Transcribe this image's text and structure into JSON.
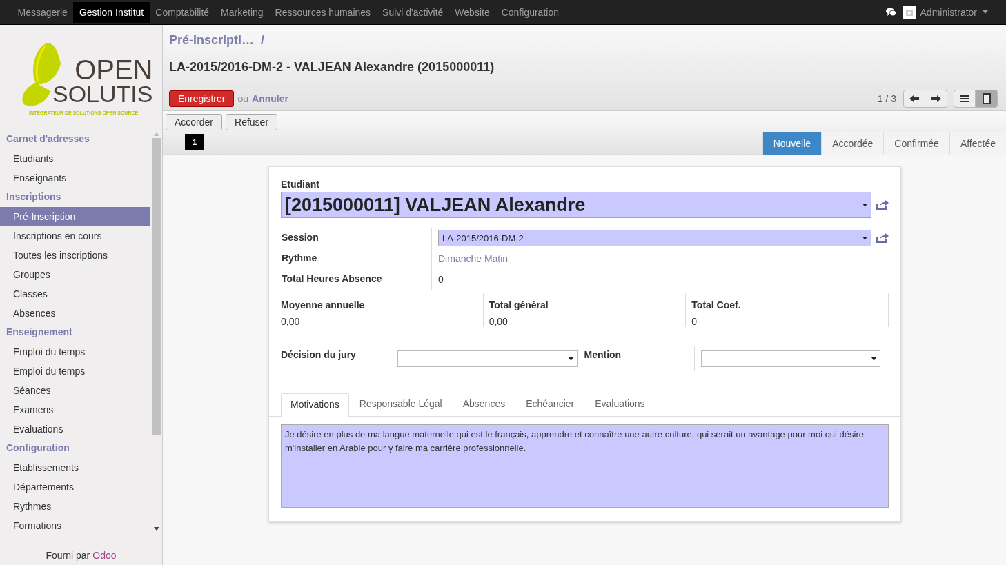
{
  "top_menu": [
    {
      "label": "Messagerie",
      "selected": false
    },
    {
      "label": "Gestion Institut",
      "selected": true
    },
    {
      "label": "Comptabilité",
      "selected": false
    },
    {
      "label": "Marketing",
      "selected": false
    },
    {
      "label": "Ressources humaines",
      "selected": false
    },
    {
      "label": "Suivi d'activité",
      "selected": false
    },
    {
      "label": "Website",
      "selected": false
    },
    {
      "label": "Configuration",
      "selected": false
    }
  ],
  "user": {
    "name": "Administrator"
  },
  "logo": {
    "line_1": "OPEN",
    "line_2": "SOLUTIS",
    "tagline": "INTEGRATEUR DE SOLUTIONS OPEN SOURCE"
  },
  "sidebar": {
    "sections": [
      {
        "title": "Carnet d'adresses",
        "items": [
          {
            "label": "Etudiants",
            "selected": false
          },
          {
            "label": "Enseignants",
            "selected": false
          }
        ]
      },
      {
        "title": "Inscriptions",
        "items": [
          {
            "label": "Pré-Inscription",
            "selected": true
          },
          {
            "label": "Inscriptions en cours",
            "selected": false
          },
          {
            "label": "Toutes les inscriptions",
            "selected": false
          },
          {
            "label": "Groupes",
            "selected": false
          },
          {
            "label": "Classes",
            "selected": false
          },
          {
            "label": "Absences",
            "selected": false
          }
        ]
      },
      {
        "title": "Enseignement",
        "items": [
          {
            "label": "Emploi du temps",
            "selected": false
          },
          {
            "label": "Emploi du temps",
            "selected": false
          },
          {
            "label": "Séances",
            "selected": false
          },
          {
            "label": "Examens",
            "selected": false
          },
          {
            "label": "Evaluations",
            "selected": false
          }
        ]
      },
      {
        "title": "Configuration",
        "items": [
          {
            "label": "Etablissements",
            "selected": false
          },
          {
            "label": "Départements",
            "selected": false
          },
          {
            "label": "Rythmes",
            "selected": false
          },
          {
            "label": "Formations",
            "selected": false
          }
        ]
      }
    ],
    "footer_text": "Fourni par",
    "footer_link": "Odoo"
  },
  "breadcrumb": {
    "parent": "Pré-Inscripti…",
    "separator": "/"
  },
  "record_title": "LA-2015/2016-DM-2 - VALJEAN Alexandre (2015000011)",
  "save_button": "Enregistrer",
  "or_text": "ou",
  "cancel_link": "Annuler",
  "pager": "1 / 3",
  "view_switch": [
    {
      "kind": "list",
      "selected": false
    },
    {
      "kind": "form",
      "selected": true
    }
  ],
  "action_buttons": [
    "Accorder",
    "Refuser"
  ],
  "badge": "1",
  "stages": [
    {
      "label": "Nouvelle",
      "selected": true
    },
    {
      "label": "Accordée",
      "selected": false
    },
    {
      "label": "Confirmée",
      "selected": false
    },
    {
      "label": "Affectée",
      "selected": false
    }
  ],
  "form": {
    "student_label": "Etudiant",
    "student_value": "[2015000011] VALJEAN Alexandre",
    "fields": [
      {
        "label": "Session",
        "kind": "select",
        "value": "LA-2015/2016-DM-2"
      },
      {
        "label": "Rythme",
        "kind": "link",
        "value": "Dimanche Matin"
      },
      {
        "label": "Total Heures Absence",
        "kind": "text",
        "value": "0"
      }
    ],
    "stats": [
      {
        "label": "Moyenne annuelle",
        "value": "0,00"
      },
      {
        "label": "Total général",
        "value": "0,00"
      },
      {
        "label": "Total Coef.",
        "value": "0"
      }
    ],
    "selects": [
      {
        "label": "Décision du jury"
      },
      {
        "label": "Mention"
      }
    ],
    "tabs": [
      {
        "label": "Motivations",
        "selected": true
      },
      {
        "label": "Responsable Légal",
        "selected": false
      },
      {
        "label": "Absences",
        "selected": false
      },
      {
        "label": "Echéancier",
        "selected": false
      },
      {
        "label": "Evaluations",
        "selected": false
      }
    ],
    "motivation": "Je désire en plus de ma langue maternelle qui est le français, apprendre et connaître une autre culture, qui serait un avantage pour moi qui désire m'installer en Arabie pour y faire ma carrière professionnelle."
  }
}
